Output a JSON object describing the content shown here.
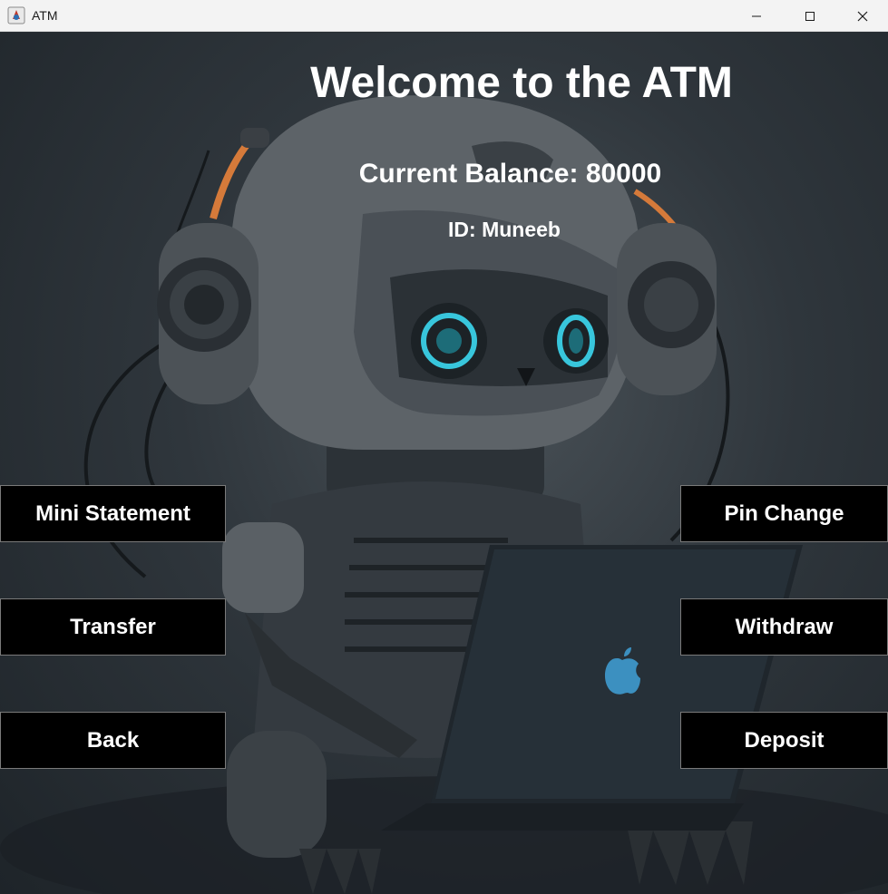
{
  "window": {
    "title": "ATM",
    "icon": "java-app-icon"
  },
  "main": {
    "welcome": "Welcome to the ATM",
    "balance": "Current Balance: 80000",
    "user_id": "ID: Muneeb"
  },
  "buttons": {
    "mini_statement": "Mini Statement",
    "transfer": "Transfer",
    "back": "Back",
    "pin_change": "Pin Change",
    "withdraw": "Withdraw",
    "deposit": "Deposit"
  },
  "colors": {
    "button_bg": "#000000",
    "button_text": "#ffffff",
    "heading_text": "#ffffff",
    "eye_glow": "#38c6dc"
  }
}
